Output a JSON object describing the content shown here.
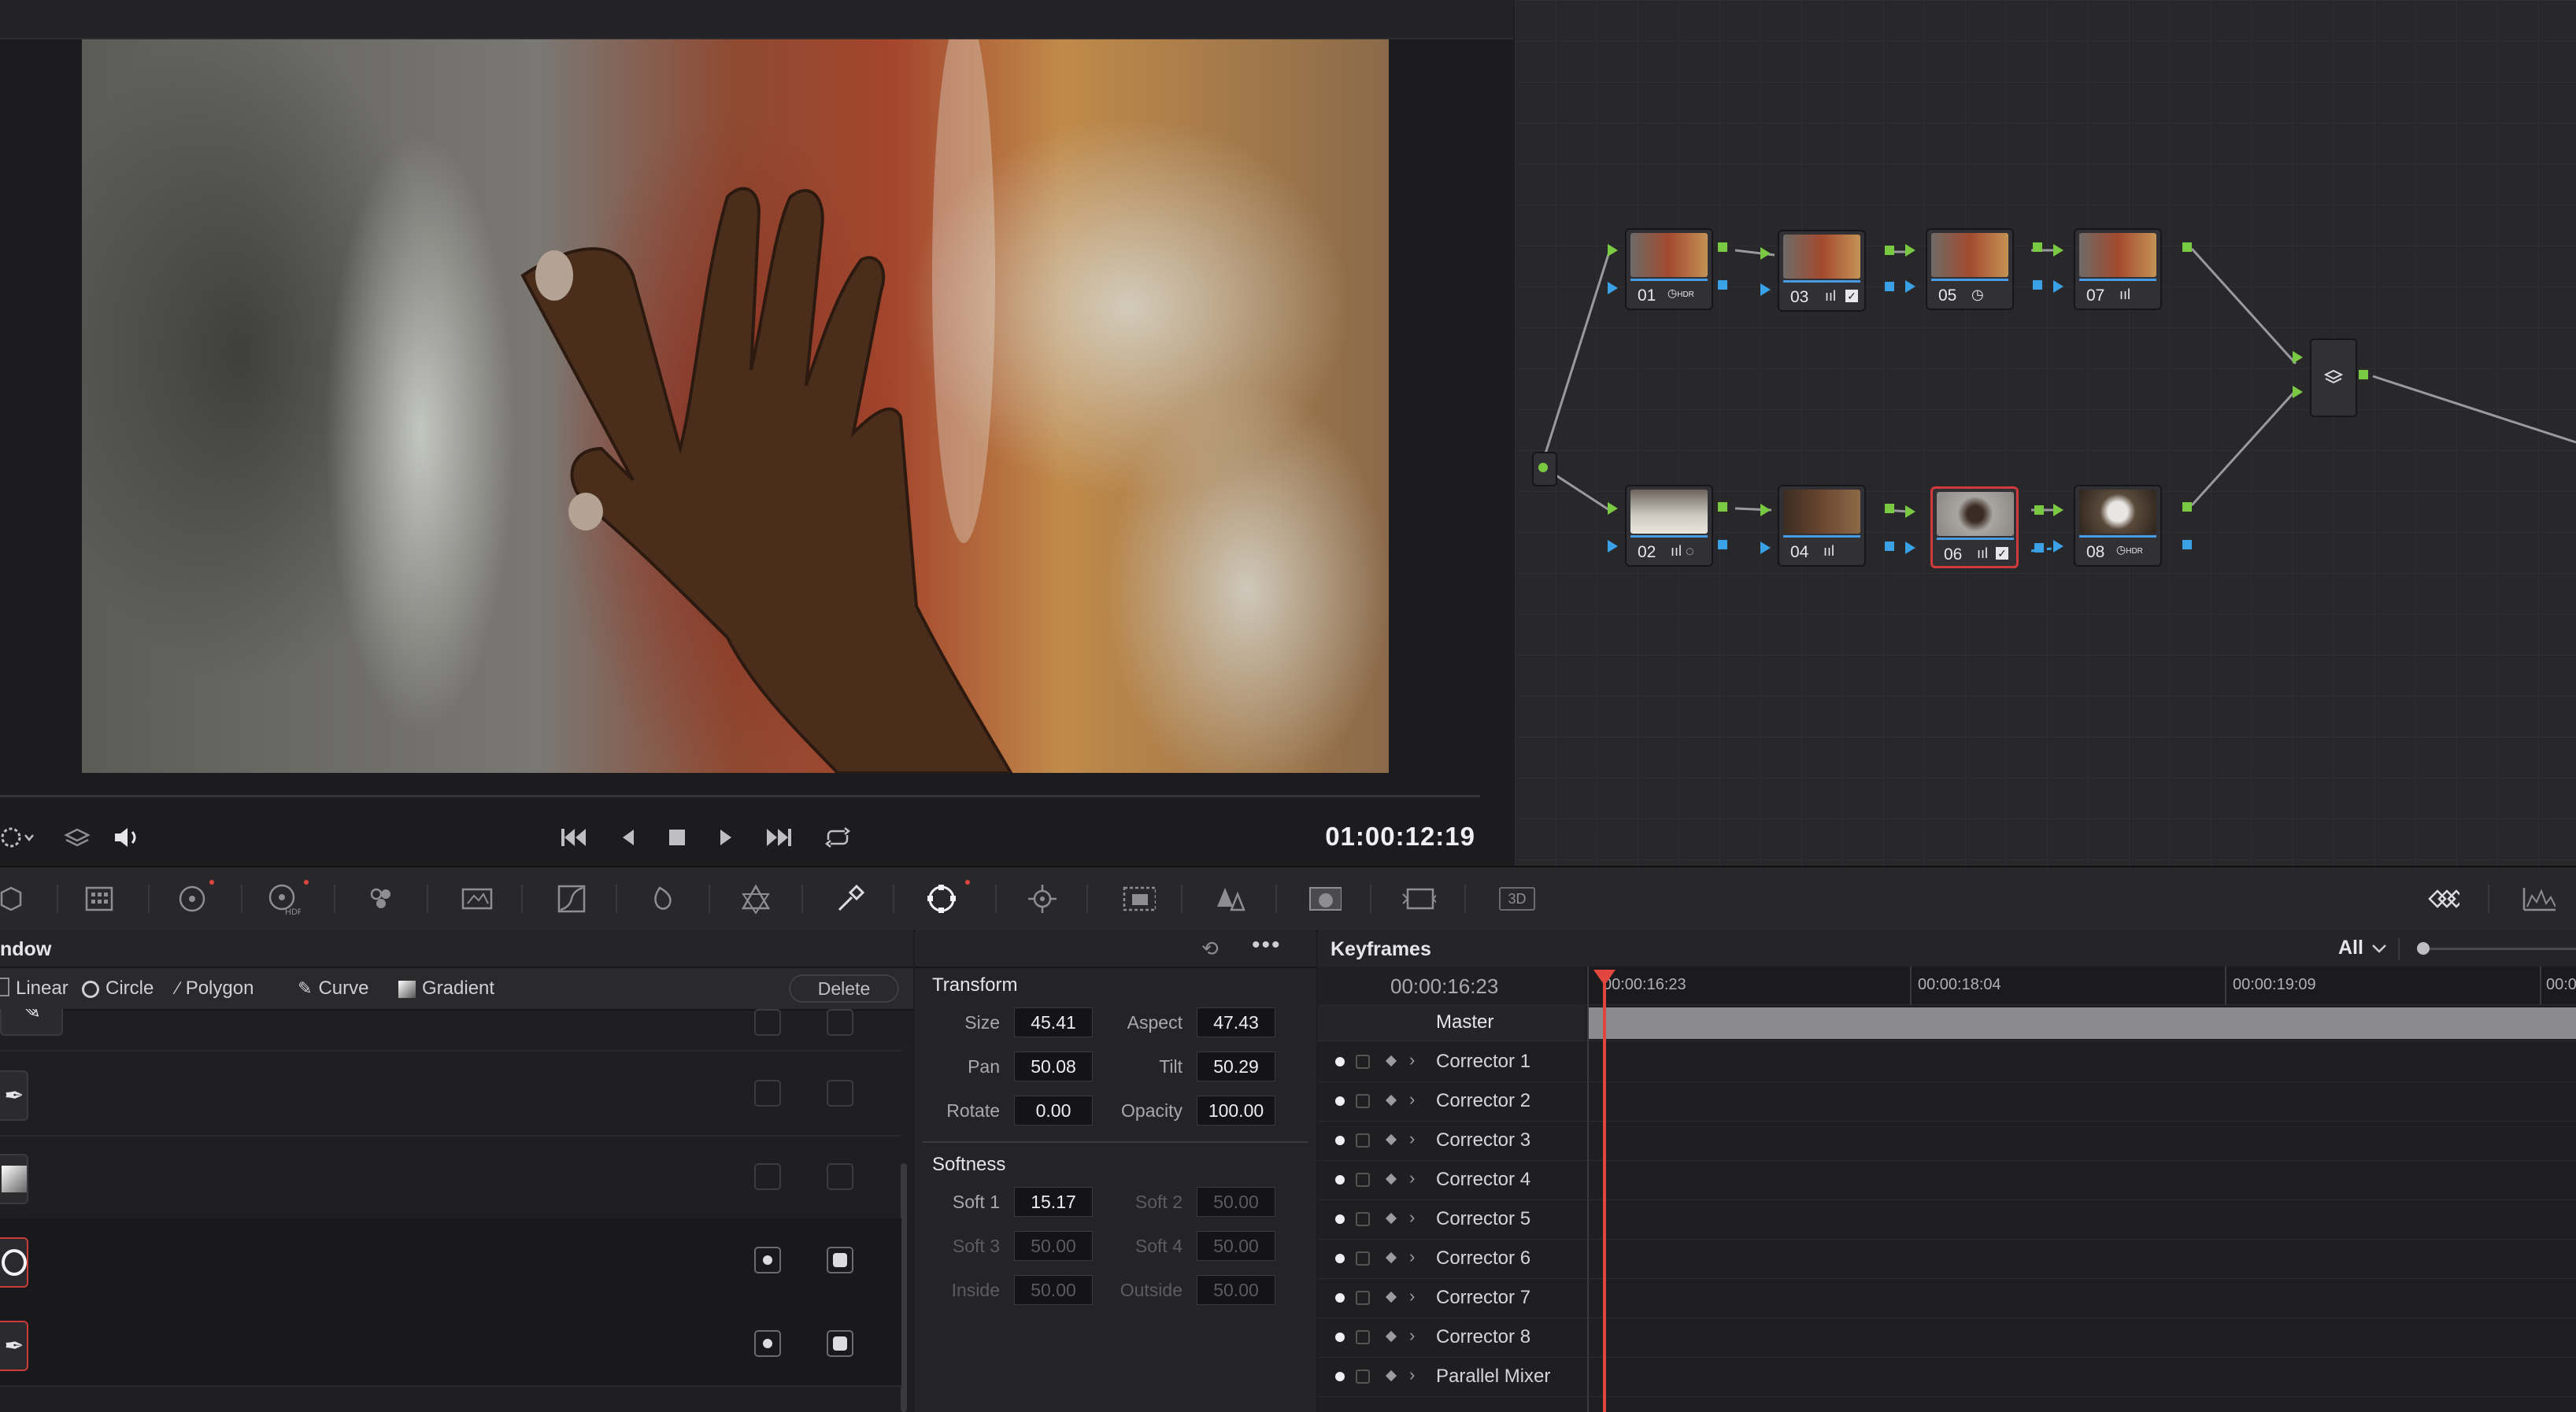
{
  "viewer": {
    "timecode": "01:00:12:19",
    "transport": [
      "skip-to-start",
      "step-back",
      "stop",
      "play",
      "skip-to-end",
      "loop"
    ]
  },
  "node_graph": {
    "nodes": [
      {
        "id": "01",
        "badge": "HDR"
      },
      {
        "id": "03",
        "badge": "bars-check"
      },
      {
        "id": "05",
        "badge": "clock"
      },
      {
        "id": "07",
        "badge": "bars"
      },
      {
        "id": "02",
        "badge": "bars-dotcircle"
      },
      {
        "id": "04",
        "badge": "bars"
      },
      {
        "id": "06",
        "badge": "bars-check",
        "selected": true
      },
      {
        "id": "08",
        "badge": "HDR"
      }
    ]
  },
  "palette": {
    "right_label": "3D"
  },
  "window_panel": {
    "title": "ndow",
    "shapes": [
      "Linear",
      "Circle",
      "Polygon",
      "Curve",
      "Gradient"
    ],
    "delete_label": "Delete",
    "rows": [
      "pen",
      "pen",
      "gradient",
      "circle",
      "pen"
    ]
  },
  "transform": {
    "title": "Transform",
    "size_label": "Size",
    "size": "45.41",
    "aspect_label": "Aspect",
    "aspect": "47.43",
    "pan_label": "Pan",
    "pan": "50.08",
    "tilt_label": "Tilt",
    "tilt": "50.29",
    "rotate_label": "Rotate",
    "rotate": "0.00",
    "opacity_label": "Opacity",
    "opacity": "100.00"
  },
  "softness": {
    "title": "Softness",
    "soft1_label": "Soft 1",
    "soft1": "15.17",
    "soft2_label": "Soft 2",
    "soft2": "50.00",
    "soft3_label": "Soft 3",
    "soft3": "50.00",
    "soft4_label": "Soft 4",
    "soft4": "50.00",
    "inside_label": "Inside",
    "inside": "50.00",
    "outside_label": "Outside",
    "outside": "50.00"
  },
  "keyframes": {
    "title": "Keyframes",
    "filter": "All",
    "current_tc": "00:00:16:23",
    "ruler": [
      "00:00:16:23",
      "00:00:18:04",
      "00:00:19:09",
      "00:0"
    ],
    "tracks": [
      "Master",
      "Corrector 1",
      "Corrector 2",
      "Corrector 3",
      "Corrector 4",
      "Corrector 5",
      "Corrector 6",
      "Corrector 7",
      "Corrector 8",
      "Parallel Mixer"
    ]
  },
  "colors": {
    "accent_red": "#d13a3a",
    "port_green": "#7ac943",
    "port_blue": "#3aa1e6"
  }
}
